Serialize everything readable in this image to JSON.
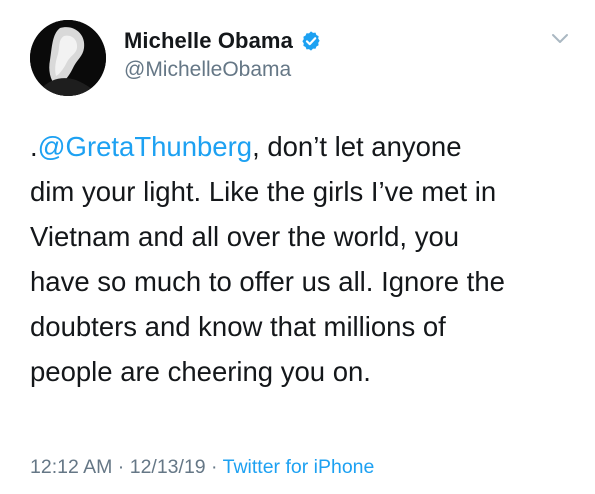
{
  "user": {
    "display_name": "Michelle Obama",
    "handle": "@MichelleObama",
    "verified": true,
    "verified_color": "#1da1f2"
  },
  "tweet": {
    "prefix": ".",
    "mention": "@GretaThunberg",
    "body": ", don’t let anyone\ndim your light. Like the girls I’ve met in\nVietnam and all over the world, you\nhave so much to offer us all. Ignore the\ndoubters and know that millions of\npeople are cheering you on."
  },
  "meta": {
    "time": "12:12 AM",
    "sep1": " · ",
    "date": "12/13/19",
    "sep2": " · ",
    "source": "Twitter for iPhone"
  },
  "icons": {
    "avatar": "profile-photo",
    "verified": "verified-badge-icon",
    "menu": "chevron-down-icon"
  },
  "colors": {
    "link": "#1da1f2",
    "secondary_text": "#657786",
    "primary_text": "#14171a"
  }
}
